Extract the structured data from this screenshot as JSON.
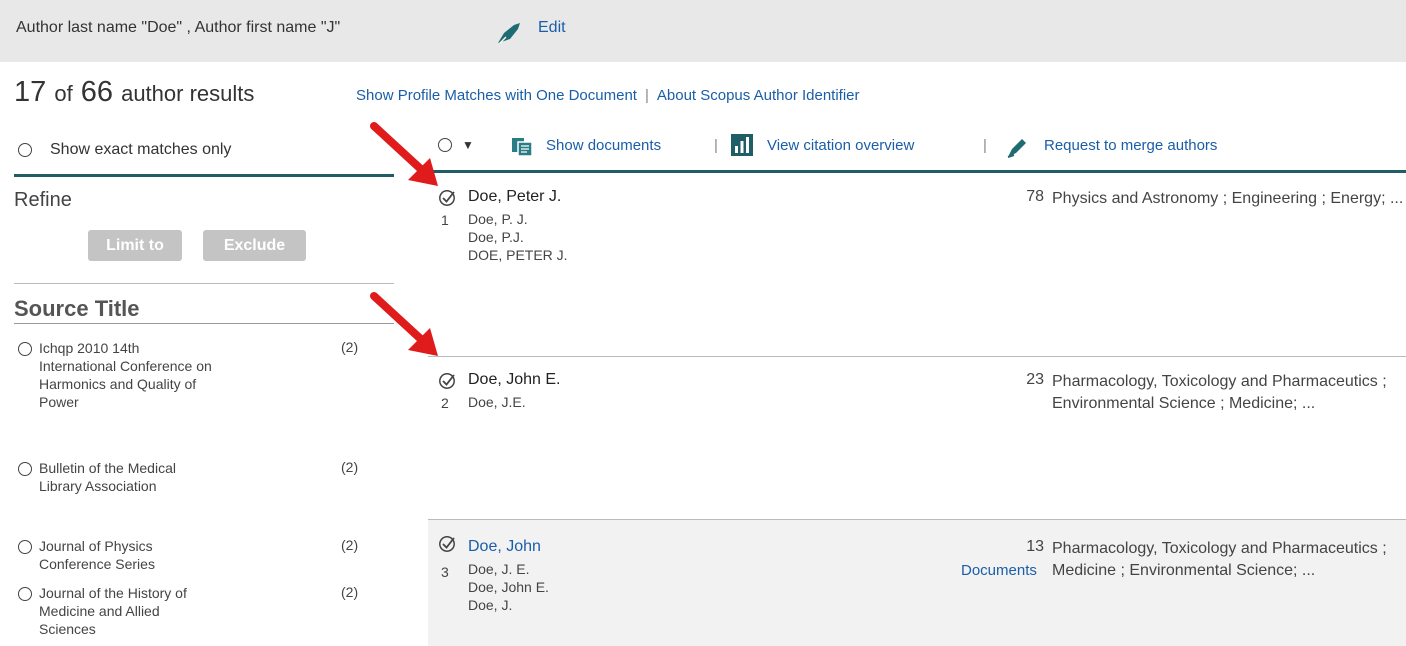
{
  "search": {
    "query_text": "Author last name \"Doe\" , Author first name \"J\"",
    "edit_label": "Edit"
  },
  "summary": {
    "shown": "17",
    "of_label": "of",
    "total": "66",
    "results_label": "author results",
    "link_one_doc": "Show Profile Matches with One Document",
    "separator": "|",
    "link_about": "About Scopus Author Identifier"
  },
  "left_panel": {
    "exact_label": "Show exact matches only",
    "refine_title": "Refine",
    "limit_label": "Limit to",
    "exclude_label": "Exclude",
    "source_title_heading": "Source Title",
    "sources": [
      {
        "name": "Ichqp 2010 14th International Conference on Harmonics and Quality of Power",
        "count": "(2)"
      },
      {
        "name": "Bulletin of the Medical Library Association",
        "count": "(2)"
      },
      {
        "name": "Journal of Physics Conference Series",
        "count": "(2)"
      },
      {
        "name": "Journal of the History of Medicine and Allied Sciences",
        "count": "(2)"
      }
    ]
  },
  "toolbar": {
    "show_documents": "Show documents",
    "separator": "|",
    "view_citation": "View citation overview",
    "request_merge": "Request to merge authors"
  },
  "results": [
    {
      "num": "1",
      "name": "Doe, Peter J.",
      "variants": [
        "Doe, P. J.",
        "Doe, P.J.",
        "DOE, PETER J."
      ],
      "documents": "78",
      "subjects": "Physics and Astronomy ; Engineering ; Energy; ..."
    },
    {
      "num": "2",
      "name": "Doe, John E.",
      "variants": [
        "Doe, J.E."
      ],
      "documents": "23",
      "subjects": "Pharmacology, Toxicology and Pharmaceutics ; Environmental Science ; Medicine; ..."
    },
    {
      "num": "3",
      "name": "Doe, John",
      "variants": [
        "Doe, J. E.",
        "Doe, John E.",
        "Doe, J."
      ],
      "documents": "13",
      "documents_link": "Documents",
      "subjects": "Pharmacology, Toxicology and Pharmaceutics ; Medicine ; Environmental Science; ..."
    }
  ],
  "colors": {
    "link": "#1a5ea8",
    "header_bg": "#e8e8e8",
    "divider_accent": "#1f5e66",
    "annotation_arrow": "#e01b1b"
  }
}
